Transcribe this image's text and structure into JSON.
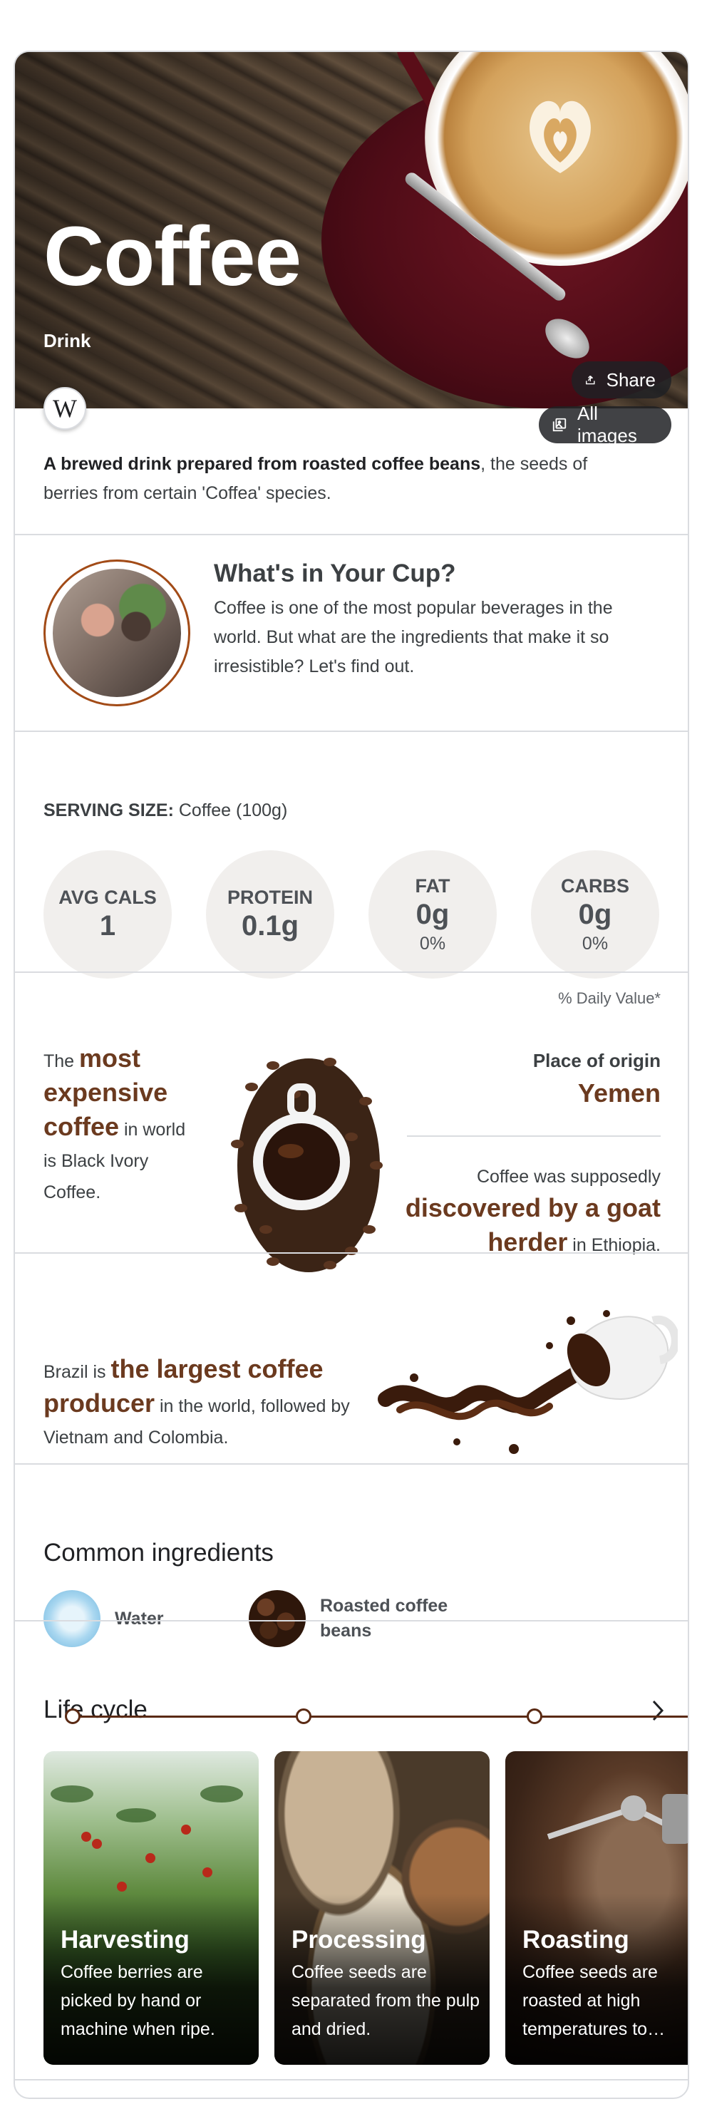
{
  "hero": {
    "title": "Coffee",
    "subtitle": "Drink",
    "share_label": "Share",
    "all_images_label": "All images",
    "source_logo": "W"
  },
  "description": {
    "bold": "A brewed drink prepared from roasted coffee beans",
    "rest": ", the seeds of berries from certain 'Coffea' species."
  },
  "cup_feature": {
    "title": "What's in Your Cup?",
    "text": "Coffee is one of the most popular beverages in the world. But what are the ingredients that make it so irresistible? Let's find out."
  },
  "nutrition": {
    "serving_label": "SERVING SIZE:",
    "serving_value": " Coffee (100g)",
    "items": [
      {
        "label": "AVG CALS",
        "value": "1",
        "pct": ""
      },
      {
        "label": "PROTEIN",
        "value": "0.1g",
        "pct": ""
      },
      {
        "label": "FAT",
        "value": "0g",
        "pct": "0%"
      },
      {
        "label": "CARBS",
        "value": "0g",
        "pct": "0%"
      }
    ],
    "daily_value_note": "% Daily Value*"
  },
  "facts": {
    "expensive_pre": "The ",
    "expensive_hl": "most expensive coffee",
    "expensive_post": " in world is Black Ivory Coffee.",
    "origin_label": "Place of origin",
    "origin_value": "Yemen",
    "discovered_pre": "Coffee was supposedly ",
    "discovered_hl": "discovered by a goat herder",
    "discovered_post": " in Ethiopia.",
    "producer_pre": "Brazil is ",
    "producer_hl": "the largest coffee producer",
    "producer_post": " in the world, followed by Vietnam and Colombia."
  },
  "ingredients": {
    "title": "Common ingredients",
    "items": [
      {
        "name": "Water"
      },
      {
        "name": "Roasted coffee beans"
      }
    ]
  },
  "life_cycle": {
    "title": "Life cycle",
    "cards": [
      {
        "title": "Harvesting",
        "text": "Coffee berries are picked by hand or machine when ripe."
      },
      {
        "title": "Processing",
        "text": "Coffee seeds are separated from the pulp and dried."
      },
      {
        "title": "Roasting",
        "text": "Coffee seeds are roasted at high temperatures to…"
      }
    ]
  },
  "colors": {
    "accent_brown": "#6b3a1f",
    "timeline": "#5a2a14",
    "nutrition_circle": "#f1efed"
  }
}
